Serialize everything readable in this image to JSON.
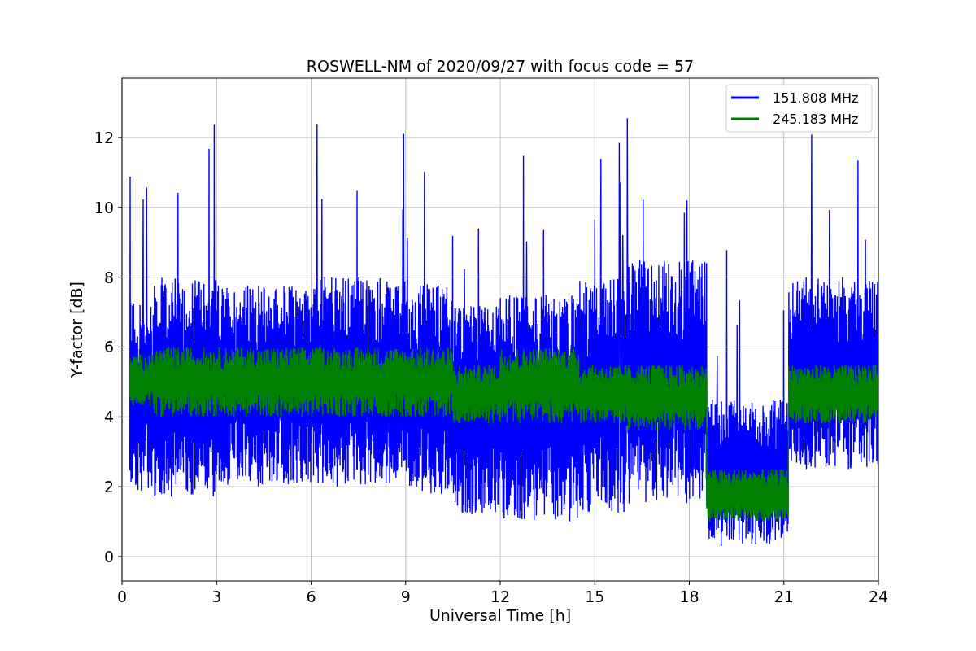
{
  "plot": {
    "title": "ROSWELL-NM of 2020/09/27 with focus code = 57",
    "xlabel": "Universal Time [h]",
    "ylabel": "Y-factor [dB]",
    "grid": true,
    "xtick_labels": [
      "0",
      "3",
      "6",
      "9",
      "12",
      "15",
      "18",
      "21",
      "24"
    ],
    "ytick_labels": [
      "12",
      "10",
      "8",
      "6",
      "4",
      "2",
      "0"
    ],
    "legend": [
      {
        "name": "151.808 MHz",
        "color": "#0000ff"
      },
      {
        "name": "245.183 MHz",
        "color": "#008000"
      }
    ]
  }
}
